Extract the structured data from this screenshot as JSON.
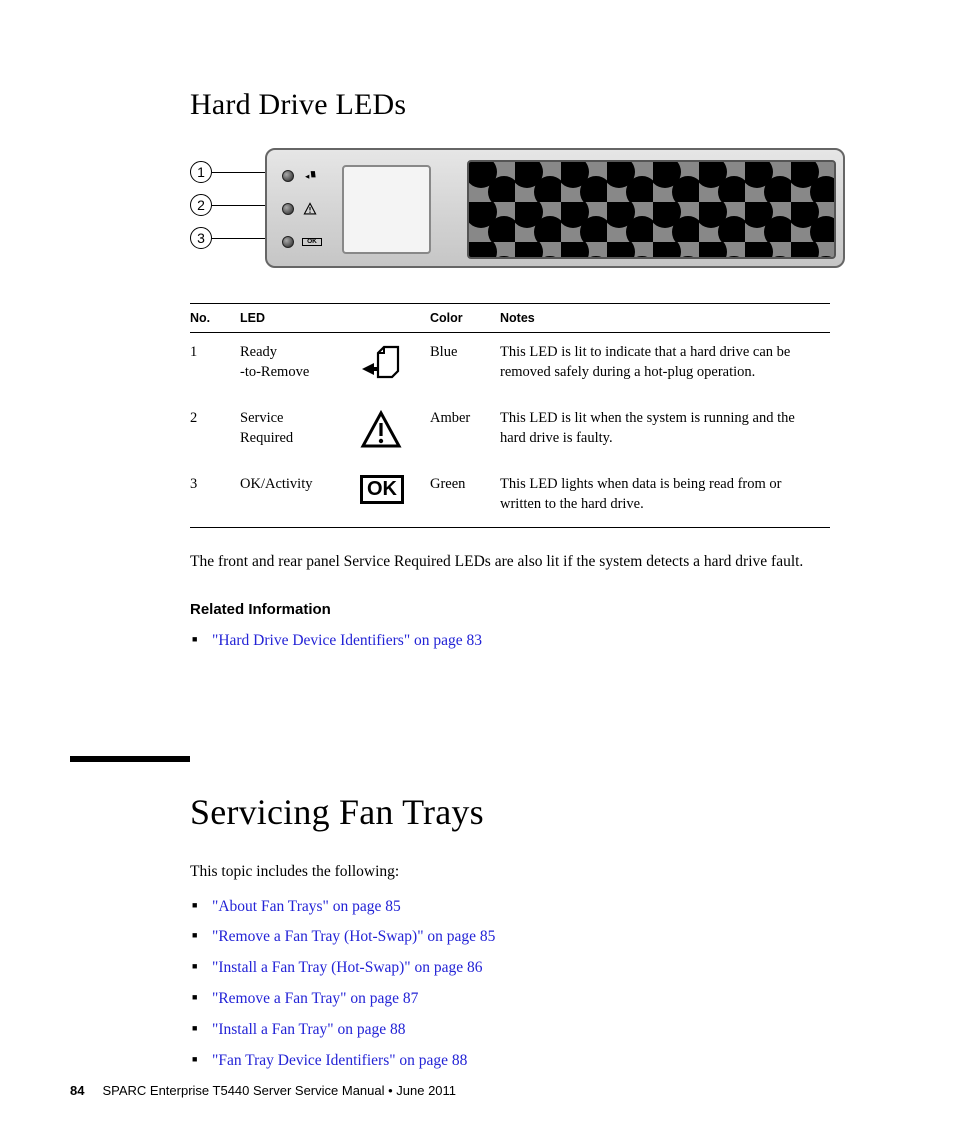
{
  "section_title": "Hard Drive LEDs",
  "callouts": [
    "1",
    "2",
    "3"
  ],
  "table": {
    "headers": {
      "no": "No.",
      "led": "LED",
      "color": "Color",
      "notes": "Notes"
    },
    "rows": [
      {
        "no": "1",
        "led_l1": "Ready",
        "led_l2": "-to-Remove",
        "color": "Blue",
        "notes": "This LED is lit to indicate that a hard drive can be removed safely during a hot-plug operation."
      },
      {
        "no": "2",
        "led_l1": "Service",
        "led_l2": "Required",
        "color": "Amber",
        "notes": "This LED is lit when the system is running and the hard drive is faulty."
      },
      {
        "no": "3",
        "led_l1": "OK/Activity",
        "led_l2": "",
        "color": "Green",
        "notes": "This LED lights when data is being read from or written to the hard drive."
      }
    ]
  },
  "after_table_text": "The front and rear panel Service Required LEDs are also lit if the system detects a hard drive fault.",
  "related_heading": "Related Information",
  "related_links": [
    {
      "text": "\"Hard Drive Device Identifiers\" on page 83"
    }
  ],
  "chapter_title": "Servicing Fan Trays",
  "chapter_intro": "This topic includes the following:",
  "chapter_links": [
    {
      "text": "\"About Fan Trays\" on page 85"
    },
    {
      "text": "\"Remove a Fan Tray (Hot-Swap)\" on page 85"
    },
    {
      "text": "\"Install a Fan Tray (Hot-Swap)\" on page 86"
    },
    {
      "text": "\"Remove a Fan Tray\" on page 87"
    },
    {
      "text": "\"Install a Fan Tray\" on page 88"
    },
    {
      "text": "\"Fan Tray Device Identifiers\" on page 88"
    }
  ],
  "footer": {
    "page_number": "84",
    "doc_title": "SPARC Enterprise T5440 Server Service Manual  •  June 2011"
  },
  "ok_label": "OK"
}
